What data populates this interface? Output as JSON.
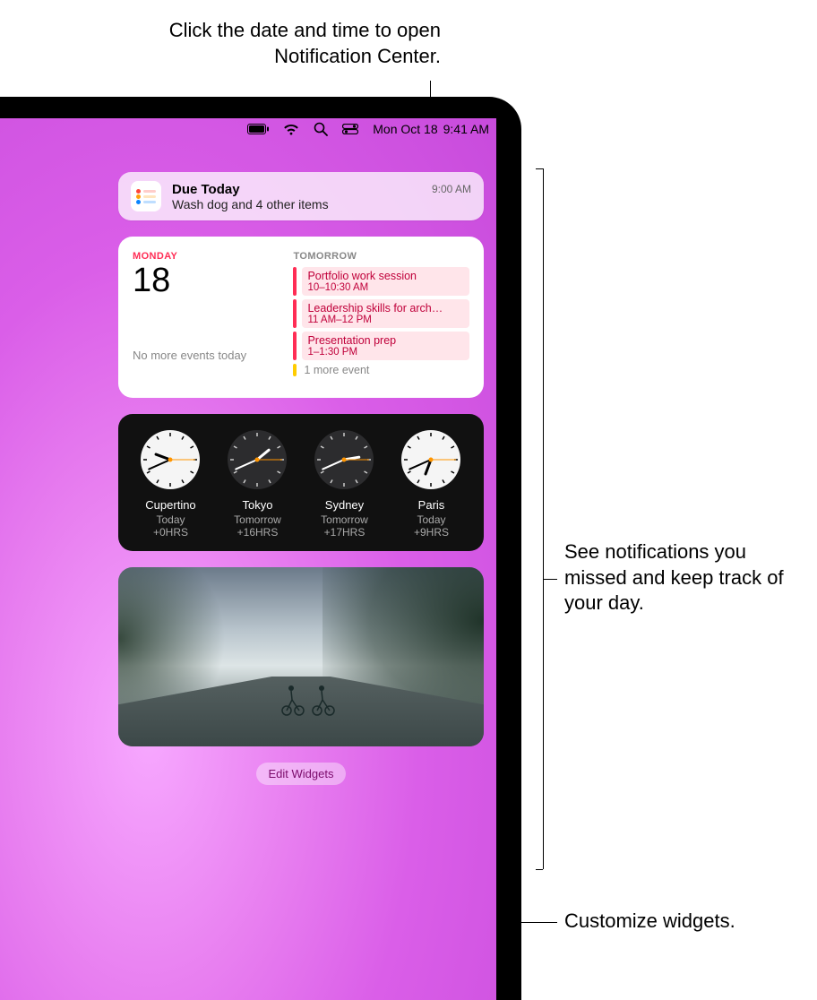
{
  "callouts": {
    "top": "Click the date and time to open Notification Center.",
    "right": "See notifications you missed and keep track of your day.",
    "bottom": "Customize widgets."
  },
  "menubar": {
    "date": "Mon Oct 18",
    "time": "9:41 AM"
  },
  "notification": {
    "title": "Due Today",
    "subtitle": "Wash dog and 4 other items",
    "time": "9:00 AM",
    "app_icon": "reminders-icon"
  },
  "calendar": {
    "day_label": "MONDAY",
    "date_number": "18",
    "no_events_text": "No more events today",
    "tomorrow_label": "TOMORROW",
    "events": [
      {
        "title": "Portfolio work session",
        "time": "10–10:30 AM",
        "color": "#ff2d55"
      },
      {
        "title": "Leadership skills for arch…",
        "time": "11 AM–12 PM",
        "color": "#ff2d55"
      },
      {
        "title": "Presentation prep",
        "time": "1–1:30 PM",
        "color": "#ff2d55"
      }
    ],
    "more_event_text": "1 more event",
    "more_event_color": "#ffcc00"
  },
  "clocks": [
    {
      "city": "Cupertino",
      "day": "Today",
      "offset": "+0HRS",
      "hour12": 9,
      "minute": 41,
      "face": "light"
    },
    {
      "city": "Tokyo",
      "day": "Tomorrow",
      "offset": "+16HRS",
      "hour12": 1,
      "minute": 41,
      "face": "dark"
    },
    {
      "city": "Sydney",
      "day": "Tomorrow",
      "offset": "+17HRS",
      "hour12": 2,
      "minute": 41,
      "face": "dark"
    },
    {
      "city": "Paris",
      "day": "Today",
      "offset": "+9HRS",
      "hour12": 6,
      "minute": 41,
      "face": "light"
    }
  ],
  "photo_widget": {
    "description": "Two cyclists riding on a misty tree-lined road"
  },
  "edit_widgets_label": "Edit Widgets"
}
